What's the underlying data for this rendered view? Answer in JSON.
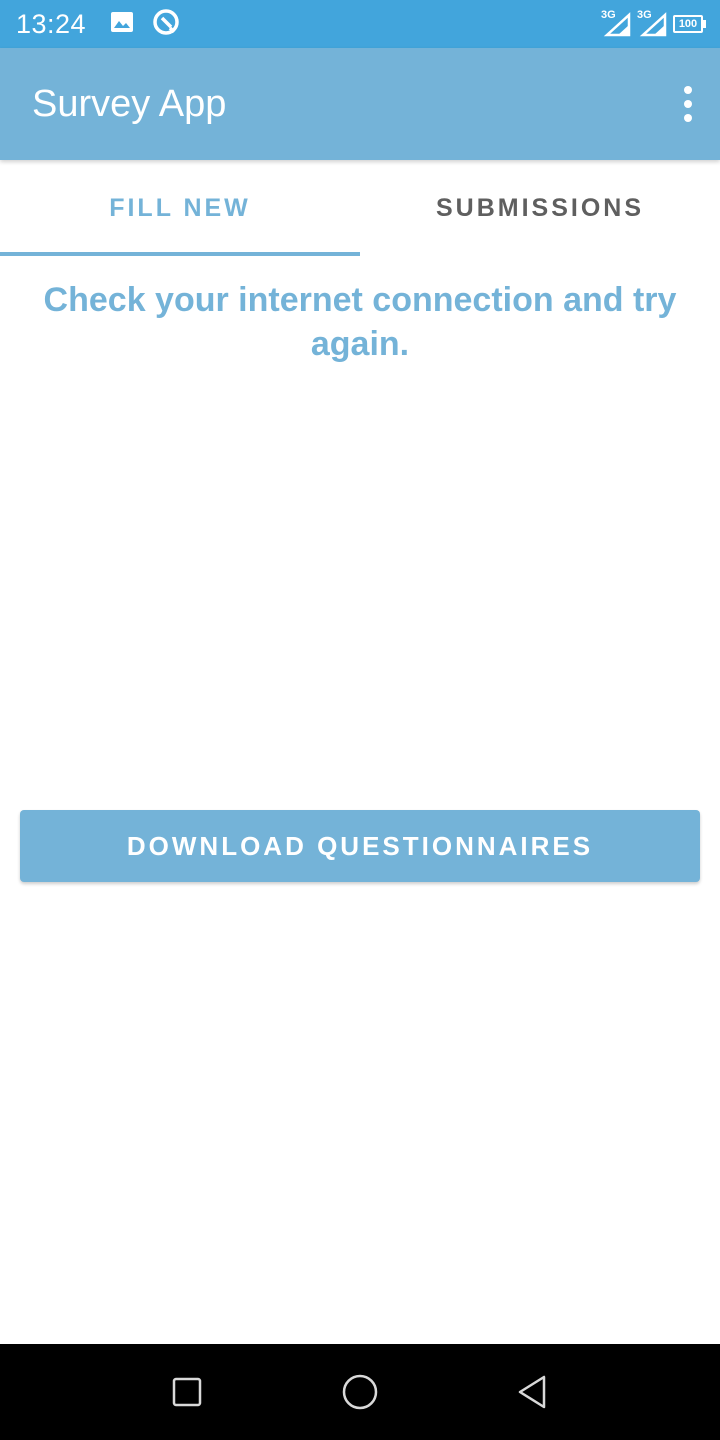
{
  "status_bar": {
    "time": "13:24",
    "icons": [
      "image-icon",
      "sync-icon"
    ],
    "signal_1": "3G",
    "signal_2": "3G",
    "battery": "100"
  },
  "app_bar": {
    "title": "Survey App",
    "menu_icon": "more-vert-icon"
  },
  "tabs": [
    {
      "label": "FILL NEW",
      "active": true
    },
    {
      "label": "SUBMISSIONS",
      "active": false
    }
  ],
  "main": {
    "message": "Check your internet connection and try again.",
    "download_button": "DOWNLOAD QUESTIONNAIRES"
  },
  "nav_bar": {
    "buttons": [
      "recents-icon",
      "home-icon",
      "back-icon"
    ]
  },
  "colors": {
    "status_bar": "#42a5dc",
    "primary": "#74b3d8",
    "inactive_tab": "#5f5f5f"
  }
}
